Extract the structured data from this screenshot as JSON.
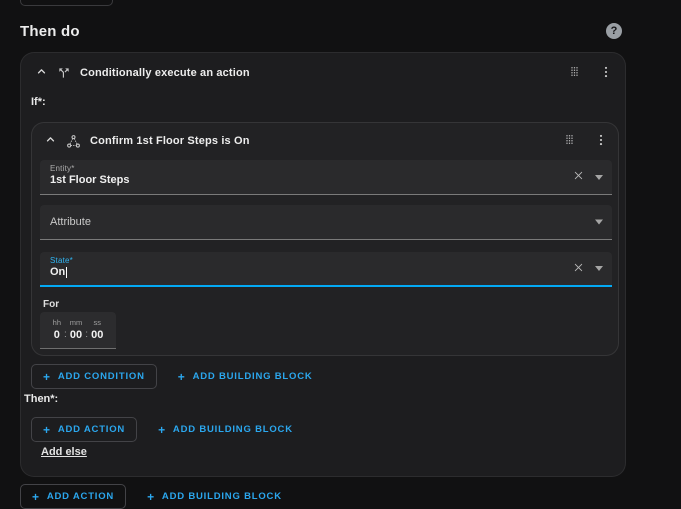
{
  "page": {
    "heading": "Then do",
    "help": "?"
  },
  "ui": {
    "plus": "+"
  },
  "outer_block": {
    "title": "Conditionally execute an action",
    "if_label": "If*:",
    "then_label": "Then*:",
    "add_condition": "ADD CONDITION",
    "add_building_block": "ADD BUILDING BLOCK",
    "add_action": "ADD ACTION",
    "add_else": "Add else"
  },
  "condition_block": {
    "title": "Confirm 1st Floor Steps is On",
    "fields": {
      "entity": {
        "label": "Entity*",
        "value": "1st Floor Steps"
      },
      "attribute": {
        "label": "Attribute",
        "value": ""
      },
      "state": {
        "label": "State*",
        "value": "On"
      }
    },
    "for": {
      "label": "For",
      "hh_label": "hh",
      "mm_label": "mm",
      "ss_label": "ss",
      "hh": "0",
      "mm": "00",
      "ss": "00",
      "sep": ":"
    }
  },
  "bottom": {
    "add_action": "ADD ACTION",
    "add_building_block": "ADD BUILDING BLOCK"
  },
  "colors": {
    "accent": "#03a9f4",
    "page_bg": "#111112",
    "card_bg": "#1d1d1f"
  }
}
